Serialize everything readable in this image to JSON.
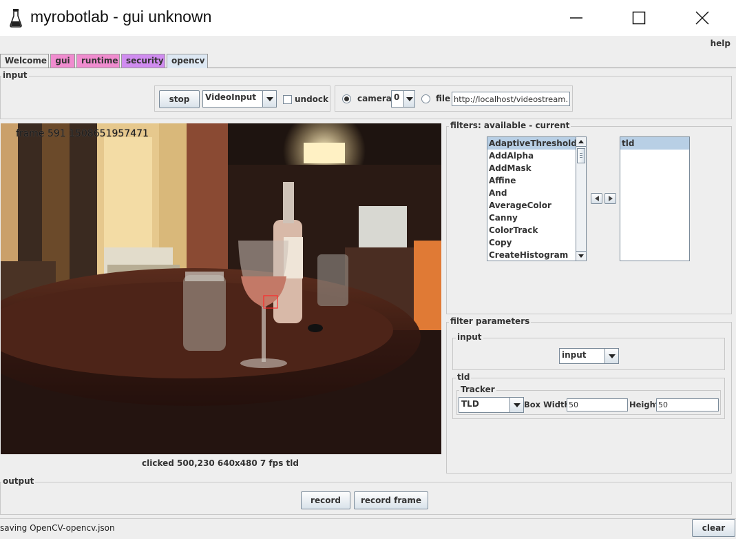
{
  "window": {
    "title": "myrobotlab - gui unknown",
    "help_label": "help"
  },
  "tabs": [
    {
      "label": "Welcome",
      "color": "#eeeeee"
    },
    {
      "label": "gui",
      "color": "#f08ccf"
    },
    {
      "label": "runtime",
      "color": "#f08ccf"
    },
    {
      "label": "security",
      "color": "#d08cf0"
    },
    {
      "label": "opencv",
      "color": "#dde8f3"
    }
  ],
  "input_panel": {
    "title": "input",
    "stop_label": "stop",
    "video_source": "VideoInput",
    "undock_label": "undock",
    "camera_label": "camera",
    "camera_index": "0",
    "file_label": "file",
    "file_value": "http://localhost/videostream.cgi",
    "camera_selected": true
  },
  "video": {
    "frame_text": "frame 591 1508651957471",
    "status": "clicked 500,230  640x480  7 fps  tld"
  },
  "filters": {
    "title": "filters: available - current",
    "available": [
      "AdaptiveThreshold",
      "AddAlpha",
      "AddMask",
      "Affine",
      "And",
      "AverageColor",
      "Canny",
      "ColorTrack",
      "Copy",
      "CreateHistogram"
    ],
    "selected_available": "AdaptiveThreshold",
    "current": [
      "tld"
    ]
  },
  "filter_parameters": {
    "title": "filter parameters",
    "input_group_title": "input",
    "input_value": "input",
    "tld_group_title": "tld",
    "tracker_title": "Tracker",
    "tracker_value": "TLD",
    "box_width_label": "Box Width:",
    "box_width_value": "50",
    "height_label": "Height:",
    "height_value": "50"
  },
  "output_panel": {
    "title": "output",
    "record_label": "record",
    "record_frame_label": "record frame"
  },
  "statusbar": {
    "message": "saving OpenCV-opencv.json",
    "clear_label": "clear"
  }
}
